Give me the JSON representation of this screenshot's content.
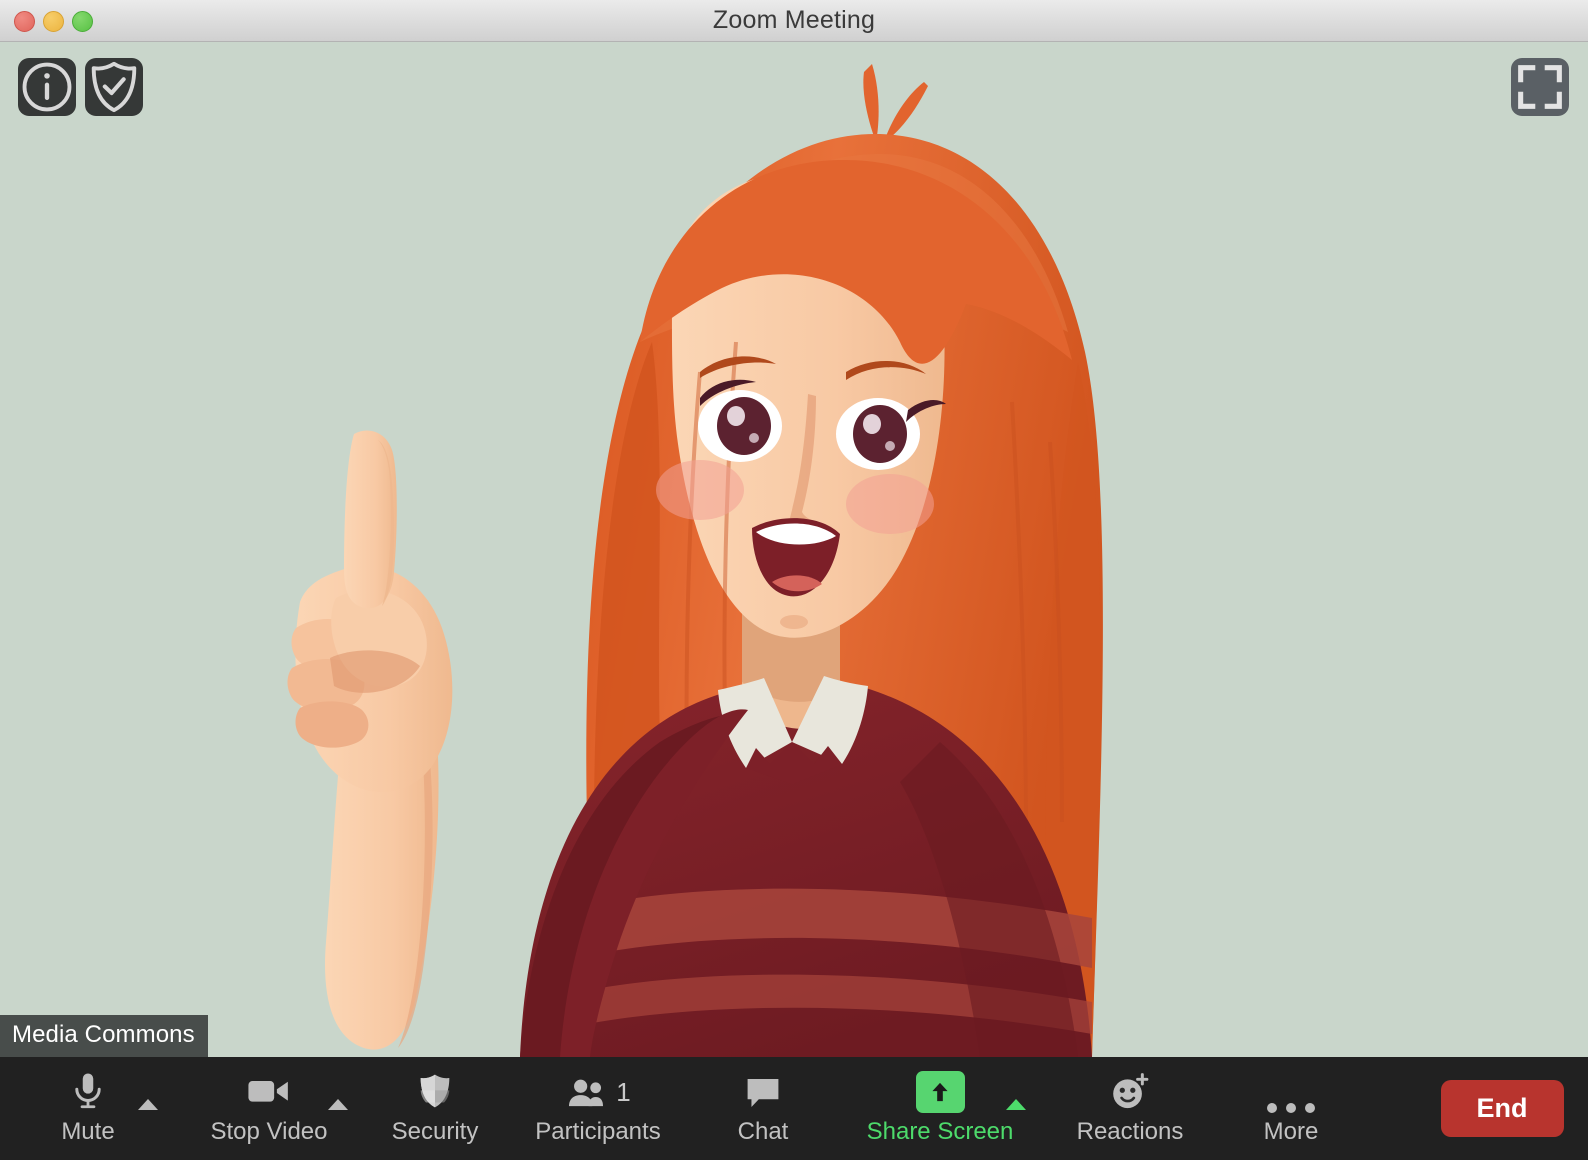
{
  "window": {
    "title": "Zoom Meeting",
    "traffic_lights": [
      {
        "name": "close",
        "color": "#e0655c"
      },
      {
        "name": "minimize",
        "color": "#ecb440"
      },
      {
        "name": "maximize",
        "color": "#58c144"
      }
    ]
  },
  "video": {
    "participant_name": "Media Commons",
    "background_color": "#c9d6cb",
    "overlay_buttons": [
      {
        "icon": "info-icon",
        "label": "Meeting Information"
      },
      {
        "icon": "shield-check-icon",
        "label": "Encryption Status"
      },
      {
        "icon": "fullscreen-icon",
        "label": "Enter Full Screen"
      }
    ],
    "subject": {
      "description": "Illustrated cartoon woman with long orange hair raising index finger",
      "hair_color": "#e2642e",
      "hair_shadow_color": "#c9501f",
      "skin_color": "#f7c9a6",
      "sweater_color": "#7d2028",
      "sweater_stripe_color": "#a8453c",
      "collar_color": "#e8e6dc"
    }
  },
  "toolbar": {
    "background_color": "#212121",
    "items": [
      {
        "id": "mute",
        "label": "Mute",
        "icon": "microphone-icon",
        "has_caret": true,
        "accent": "#c2c2c2"
      },
      {
        "id": "stop-video",
        "label": "Stop Video",
        "icon": "video-camera-icon",
        "has_caret": true,
        "accent": "#c2c2c2"
      },
      {
        "id": "security",
        "label": "Security",
        "icon": "shield-icon",
        "has_caret": false,
        "accent": "#c2c2c2"
      },
      {
        "id": "participants",
        "label": "Participants",
        "icon": "people-icon",
        "has_caret": false,
        "accent": "#c2c2c2",
        "count": "1"
      },
      {
        "id": "chat",
        "label": "Chat",
        "icon": "chat-bubble-icon",
        "has_caret": false,
        "accent": "#c2c2c2"
      },
      {
        "id": "share-screen",
        "label": "Share Screen",
        "icon": "share-arrow-icon",
        "has_caret": true,
        "accent": "#4ddb6b"
      },
      {
        "id": "reactions",
        "label": "Reactions",
        "icon": "smiley-plus-icon",
        "has_caret": false,
        "accent": "#c2c2c2"
      },
      {
        "id": "more",
        "label": "More",
        "icon": "ellipsis-icon",
        "has_caret": false,
        "accent": "#c2c2c2"
      }
    ],
    "end_button": {
      "label": "End",
      "color": "#b8342e"
    }
  }
}
